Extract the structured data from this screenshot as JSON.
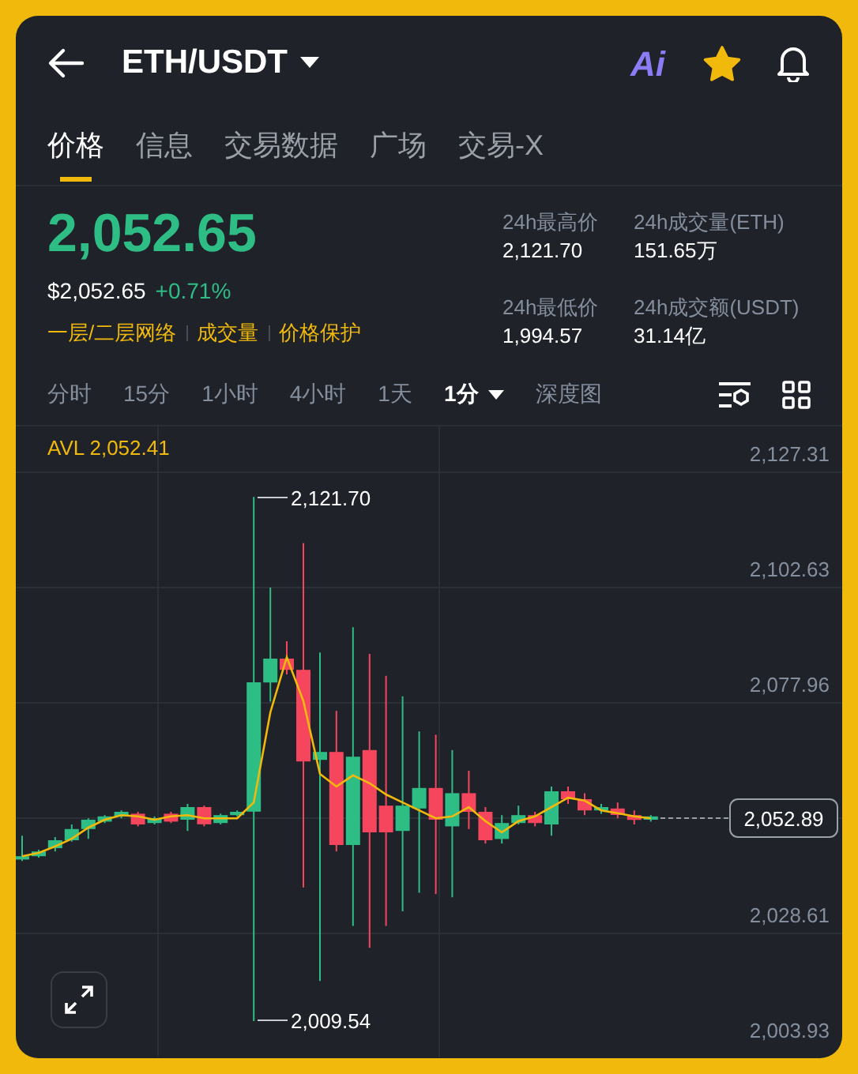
{
  "header": {
    "title": "ETH/USDT",
    "ai_label": "Ai",
    "favorite": true
  },
  "tabs": [
    {
      "label": "价格",
      "selected": true
    },
    {
      "label": "信息",
      "selected": false
    },
    {
      "label": "交易数据",
      "selected": false
    },
    {
      "label": "广场",
      "selected": false
    },
    {
      "label": "交易-X",
      "selected": false
    }
  ],
  "price": {
    "last": "2,052.65",
    "usd": "$2,052.65",
    "change": "+0.71%",
    "tags": [
      "一层/二层网络",
      "成交量",
      "价格保护"
    ]
  },
  "stats": [
    {
      "label": "24h最高价",
      "value": "2,121.70"
    },
    {
      "label": "24h成交量(ETH)",
      "value": "151.65万"
    },
    {
      "label": "24h最低价",
      "value": "1,994.57"
    },
    {
      "label": "24h成交额(USDT)",
      "value": "31.14亿"
    }
  ],
  "timeframes": [
    {
      "label": "分时",
      "selected": false
    },
    {
      "label": "15分",
      "selected": false
    },
    {
      "label": "1小时",
      "selected": false
    },
    {
      "label": "4小时",
      "selected": false
    },
    {
      "label": "1天",
      "selected": false
    },
    {
      "label": "1分",
      "selected": true,
      "kind": "dropdown"
    },
    {
      "label": "深度图",
      "selected": false
    }
  ],
  "chart": {
    "avl": "AVL 2,052.41",
    "chart_data": {
      "type": "candlestick",
      "ylim": [
        2003.93,
        2127.31
      ],
      "grid": true,
      "ohlc": [
        [
          2044.1,
          2049.2,
          2043.8,
          2044.8
        ],
        [
          2044.8,
          2046.2,
          2044.5,
          2045.8
        ],
        [
          2046.5,
          2048.9,
          2045.8,
          2048.2
        ],
        [
          2048.2,
          2051.6,
          2047.9,
          2050.6
        ],
        [
          2050.6,
          2052.9,
          2048.5,
          2052.6
        ],
        [
          2052.2,
          2053.6,
          2051.9,
          2053.3
        ],
        [
          2053.3,
          2054.6,
          2052.9,
          2054.3
        ],
        [
          2053.9,
          2054.3,
          2051.2,
          2051.6
        ],
        [
          2051.9,
          2053.3,
          2051.6,
          2052.9
        ],
        [
          2053.9,
          2054.3,
          2051.9,
          2052.2
        ],
        [
          2052.6,
          2056.0,
          2050.2,
          2055.3
        ],
        [
          2055.3,
          2055.6,
          2051.2,
          2051.6
        ],
        [
          2051.9,
          2053.9,
          2051.6,
          2053.6
        ],
        [
          2053.6,
          2054.6,
          2053.3,
          2054.3
        ],
        [
          2054.3,
          2121.7,
          2009.5,
          2082.0
        ],
        [
          2082.0,
          2102.3,
          2077.9,
          2087.1
        ],
        [
          2087.1,
          2090.8,
          2083.7,
          2084.7
        ],
        [
          2084.7,
          2111.8,
          2038.1,
          2065.1
        ],
        [
          2065.4,
          2088.4,
          2018.1,
          2067.1
        ],
        [
          2067.1,
          2075.9,
          2045.8,
          2047.2
        ],
        [
          2047.2,
          2093.8,
          2029.9,
          2066.1
        ],
        [
          2067.5,
          2088.1,
          2025.2,
          2049.9
        ],
        [
          2055.6,
          2083.4,
          2029.9,
          2049.9
        ],
        [
          2050.2,
          2079.0,
          2033.0,
          2055.6
        ],
        [
          2055.0,
          2071.5,
          2037.0,
          2059.4
        ],
        [
          2059.4,
          2070.8,
          2036.7,
          2052.6
        ],
        [
          2051.2,
          2067.5,
          2036.0,
          2058.3
        ],
        [
          2058.3,
          2063.1,
          2050.6,
          2054.3
        ],
        [
          2054.3,
          2055.3,
          2047.5,
          2048.2
        ],
        [
          2048.5,
          2053.6,
          2047.5,
          2051.9
        ],
        [
          2051.9,
          2055.6,
          2051.6,
          2053.6
        ],
        [
          2053.6,
          2054.3,
          2051.2,
          2051.9
        ],
        [
          2051.6,
          2059.7,
          2049.2,
          2058.7
        ],
        [
          2058.7,
          2059.7,
          2056.0,
          2057.0
        ],
        [
          2057.0,
          2058.3,
          2053.6,
          2054.6
        ],
        [
          2054.6,
          2056.0,
          2053.9,
          2055.3
        ],
        [
          2055.0,
          2056.3,
          2052.9,
          2053.6
        ],
        [
          2053.6,
          2054.6,
          2051.6,
          2052.6
        ],
        [
          2052.6,
          2053.6,
          2052.2,
          2053.3
        ]
      ],
      "yticks": [
        {
          "value": 2127.31,
          "label": "2,127.31"
        },
        {
          "value": 2102.63,
          "label": "2,102.63"
        },
        {
          "value": 2077.96,
          "label": "2,077.96"
        },
        {
          "value": 2028.61,
          "label": "2,028.61"
        },
        {
          "value": 2003.93,
          "label": "2,003.93"
        }
      ],
      "series": [
        {
          "type": "line",
          "color": "#f0b90b",
          "values": [
            2044.8,
            2045.5,
            2046.9,
            2048.5,
            2050.9,
            2052.6,
            2053.6,
            2053.3,
            2052.6,
            2053.3,
            2053.6,
            2052.9,
            2052.9,
            2052.9,
            2056.3,
            2075.6,
            2087.4,
            2078.0,
            2062.4,
            2059.7,
            2062.1,
            2060.4,
            2058.0,
            2056.3,
            2054.6,
            2052.9,
            2053.3,
            2055.3,
            2052.3,
            2049.9,
            2052.3,
            2053.3,
            2055.3,
            2057.3,
            2056.7,
            2054.6,
            2054.0,
            2053.3,
            2052.9
          ]
        }
      ]
    },
    "high_label": "2,121.70",
    "low_label": "2,009.54",
    "last_price": "2,052.89"
  }
}
